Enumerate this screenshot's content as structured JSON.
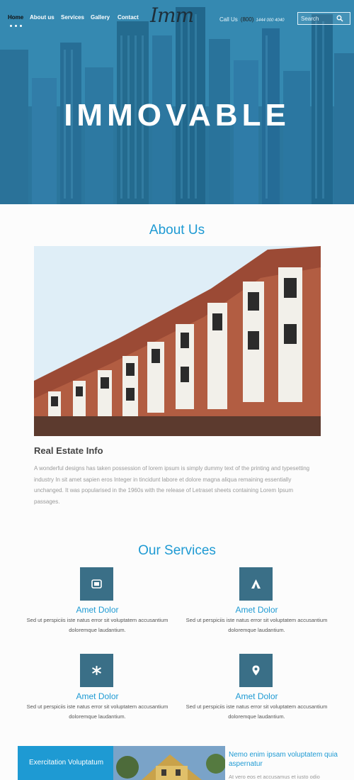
{
  "nav": {
    "items": [
      "Home",
      "About us",
      "Services",
      "Gallery",
      "Contact"
    ],
    "logo": "Imm",
    "call_label": "Call Us",
    "call_code": "(800)",
    "call_number": "1444 000 4040",
    "search_placeholder": "Search"
  },
  "hero": {
    "title": "IMMOVABLE"
  },
  "about": {
    "heading": "About Us",
    "info_title": "Real Estate Info",
    "info_text": "A wonderful designs has taken possession of lorem ipsum is simply dummy text of the printing and typesetting industry In sit amet sapien eros Integer in tincidunt labore et dolore magna aliqua remaining essentially unchanged. It was popularised in the 1960s with the release of Letraset sheets containing Lorem Ipsum passages."
  },
  "services": {
    "heading": "Our Services",
    "items": [
      {
        "title": "Amet Dolor",
        "text": "Sed ut perspiciis iste natus error sit voluptatem accusantium doloremque laudantium.",
        "icon": "camera-icon"
      },
      {
        "title": "Amet Dolor",
        "text": "Sed ut perspiciis iste natus error sit voluptatem accusantium doloremque laudantium.",
        "icon": "tent-icon"
      },
      {
        "title": "Amet Dolor",
        "text": "Sed ut perspiciis iste natus error sit voluptatem accusantium doloremque laudantium.",
        "icon": "asterisk-icon"
      },
      {
        "title": "Amet Dolor",
        "text": "Sed ut perspiciis iste natus error sit voluptatem accusantium doloremque laudantium.",
        "icon": "map-marker-icon"
      }
    ]
  },
  "bottom": {
    "blue_text": "Exercitation Voluptatum",
    "right_title": "Nemo enim ipsam voluptatem quia aspernatur",
    "right_text": "At vero eos et accusamus et iusto odio"
  },
  "colors": {
    "accent": "#1e9ad3",
    "icon_box": "#3a6f87",
    "hero_tint": "#2f7ea4"
  }
}
